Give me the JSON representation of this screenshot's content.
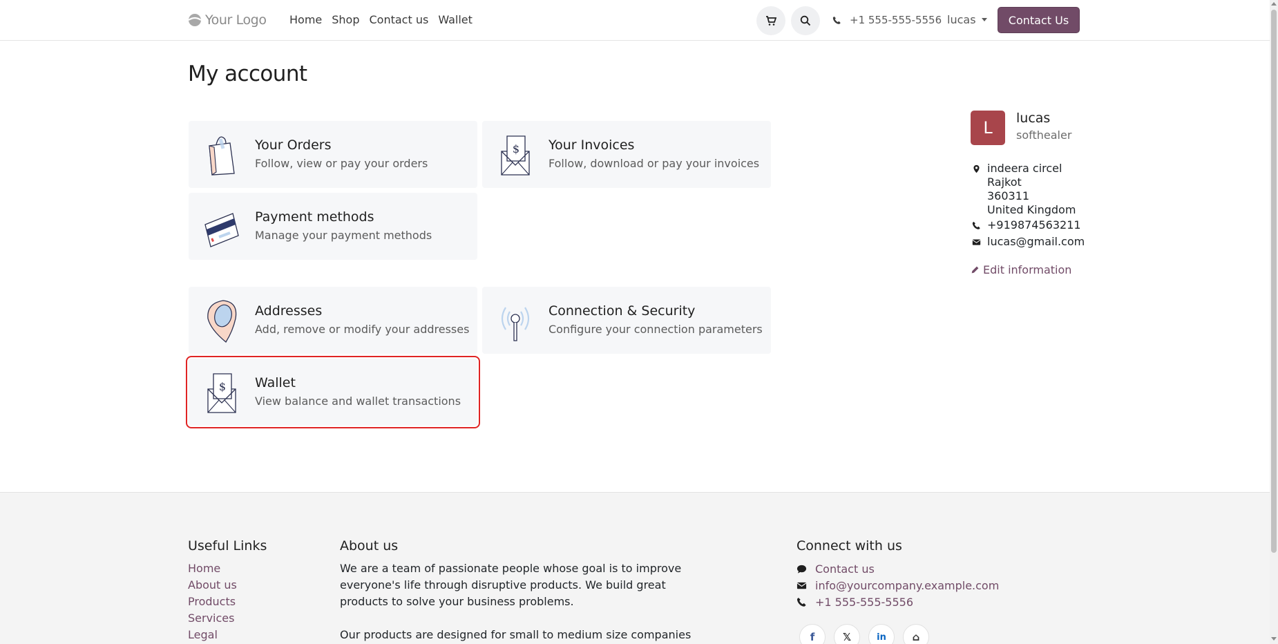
{
  "header": {
    "logo_text": "Your Logo",
    "nav": [
      "Home",
      "Shop",
      "Contact us",
      "Wallet"
    ],
    "phone": "+1 555-555-5556",
    "user": "lucas",
    "contact_button": "Contact Us"
  },
  "main": {
    "title": "My account",
    "cards": [
      {
        "title": "Your Orders",
        "description": "Follow, view or pay your orders",
        "icon": "shopping-bag-icon"
      },
      {
        "title": "Your Invoices",
        "description": "Follow, download or pay your invoices",
        "icon": "invoice-envelope-icon"
      },
      {
        "title": "Payment methods",
        "description": "Manage your payment methods",
        "icon": "credit-card-icon"
      },
      {
        "title": "Addresses",
        "description": "Add, remove or modify your addresses",
        "icon": "location-pin-icon"
      },
      {
        "title": "Connection & Security",
        "description": "Configure your connection parameters",
        "icon": "antenna-icon"
      },
      {
        "title": "Wallet",
        "description": "View balance and wallet transactions",
        "icon": "wallet-envelope-icon"
      }
    ]
  },
  "profile": {
    "initial": "L",
    "name": "lucas",
    "company": "softhealer",
    "address": [
      "indeera circel",
      "Rajkot",
      "360311",
      "United Kingdom"
    ],
    "phone": "+919874563211",
    "email": "lucas@gmail.com",
    "edit_label": "Edit information"
  },
  "footer": {
    "useful_links_title": "Useful Links",
    "useful_links": [
      "Home",
      "About us",
      "Products",
      "Services",
      "Legal"
    ],
    "about_title": "About us",
    "about_text_1": "We are a team of passionate people whose goal is to improve everyone's life through disruptive products. We build great products to solve your business problems.",
    "about_text_2": "Our products are designed for small to medium size companies",
    "connect_title": "Connect with us",
    "connect_contact": "Contact us",
    "connect_email": "info@yourcompany.example.com",
    "connect_phone": "+1 555-555-5556",
    "social": [
      "f",
      "𝕏",
      "in",
      "⌂"
    ]
  },
  "colors": {
    "brand": "#714b67",
    "avatar": "#a8454b",
    "highlight": "#e02424",
    "card_bg": "#f6f7f9"
  }
}
